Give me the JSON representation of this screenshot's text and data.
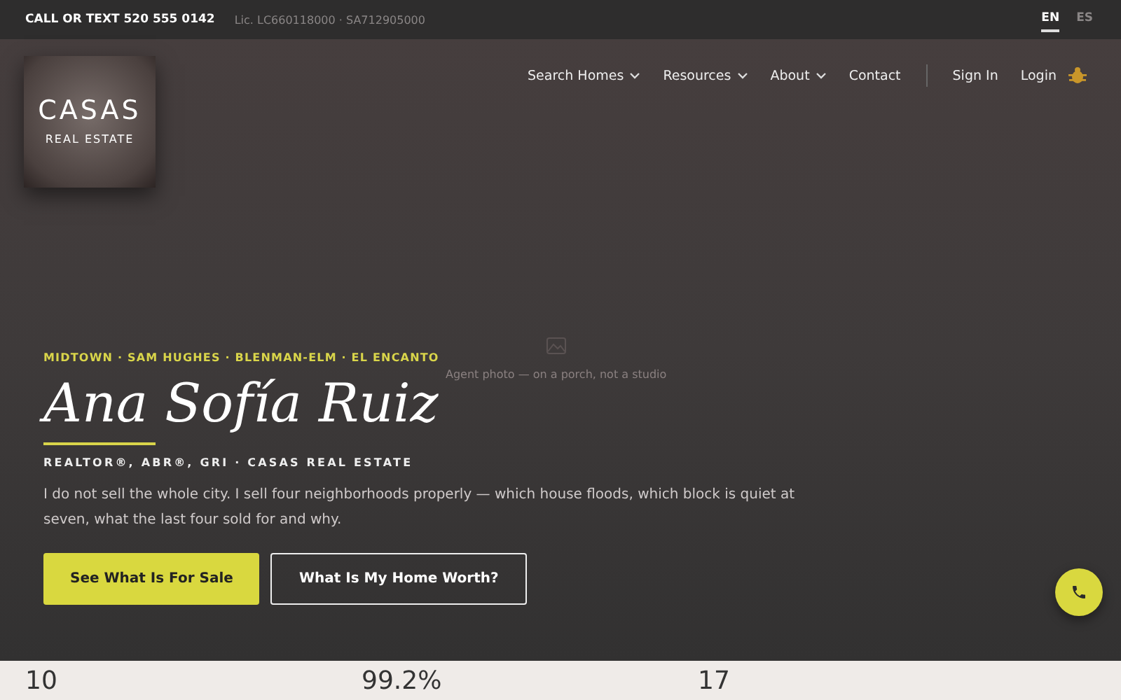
{
  "topbar": {
    "phone": "CALL OR TEXT 520 555 0142",
    "license": "Lic. LC660118000 · SA712905000",
    "languages": [
      {
        "label": "EN",
        "selected": true
      },
      {
        "label": "ES",
        "selected": false
      }
    ]
  },
  "logo": {
    "name": "CASAS",
    "tagline": "REAL ESTATE"
  },
  "nav": {
    "items": [
      {
        "label": "Search Homes",
        "dropdown": true
      },
      {
        "label": "Resources",
        "dropdown": true
      },
      {
        "label": "About",
        "dropdown": true
      },
      {
        "label": "Contact",
        "dropdown": false
      }
    ],
    "sign_in": "Sign In",
    "login": "Login"
  },
  "hero": {
    "photo_caption": "Agent photo — on a porch, not a studio",
    "neighborhoods": "MIDTOWN · SAM HUGHES · BLENMAN-ELM · EL ENCANTO",
    "name": "Ana Sofía Ruiz",
    "credentials": "REALTOR®, ABR®, GRI · CASAS REAL ESTATE",
    "intro": "I do not sell the whole city. I sell four neighborhoods properly — which house floods, which block is quiet at seven, what the last four sold for and why.",
    "buttons": [
      {
        "label": "See What Is For Sale",
        "kind": "primary"
      },
      {
        "label": "What Is My Home Worth?",
        "kind": "outline"
      }
    ]
  },
  "stats": [
    "10",
    "99.2%",
    "17"
  ]
}
